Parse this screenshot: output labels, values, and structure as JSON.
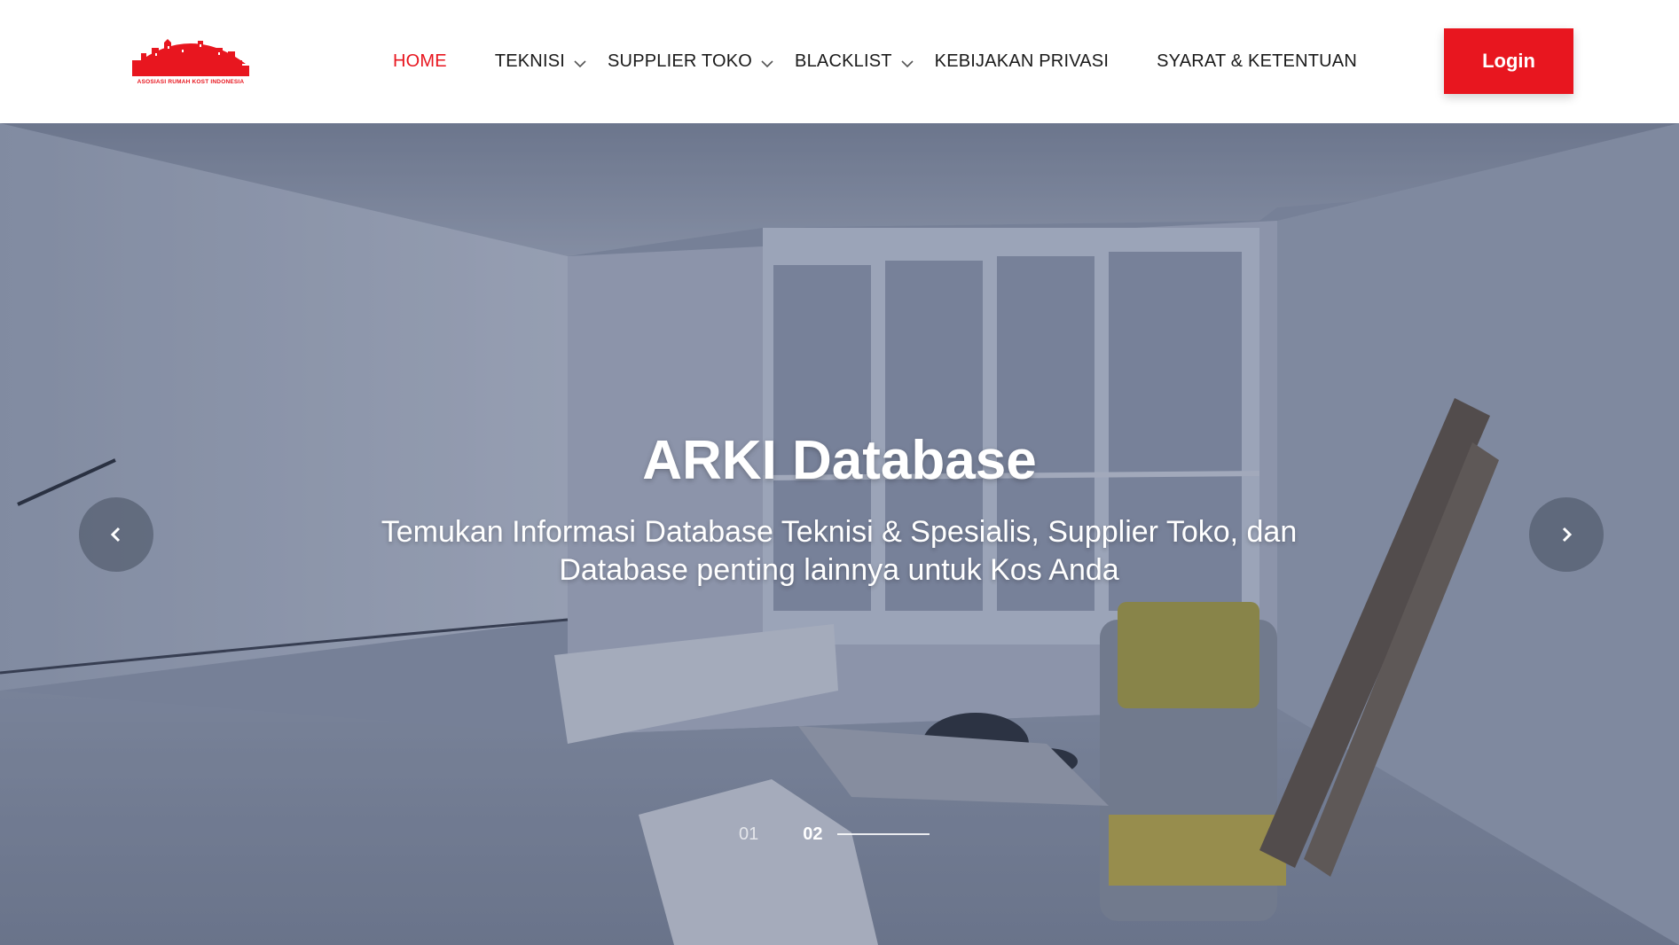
{
  "brand": {
    "logo_text": "ASOSIASI RUMAH KOST INDONESIA",
    "color": "#e8161f"
  },
  "nav": {
    "items": [
      {
        "label": "HOME",
        "active": true,
        "dropdown": false
      },
      {
        "label": "TEKNISI",
        "active": false,
        "dropdown": true
      },
      {
        "label": "SUPPLIER TOKO",
        "active": false,
        "dropdown": true
      },
      {
        "label": "BLACKLIST",
        "active": false,
        "dropdown": true
      },
      {
        "label": "KEBIJAKAN PRIVASI",
        "active": false,
        "dropdown": false
      },
      {
        "label": "SYARAT & KETENTUAN",
        "active": false,
        "dropdown": false
      }
    ],
    "login_label": "Login"
  },
  "hero": {
    "title": "ARKI Database",
    "subtitle": "Temukan Informasi Database Teknisi & Spesialis, Supplier Toko, dan Database penting lainnya untuk Kos Anda",
    "prev_icon": "chevron-left-icon",
    "next_icon": "chevron-right-icon",
    "pager": {
      "slides": [
        "01",
        "02"
      ],
      "current": "02"
    }
  },
  "colors": {
    "accent": "#e8161f",
    "nav_text": "#1a1a1a"
  }
}
